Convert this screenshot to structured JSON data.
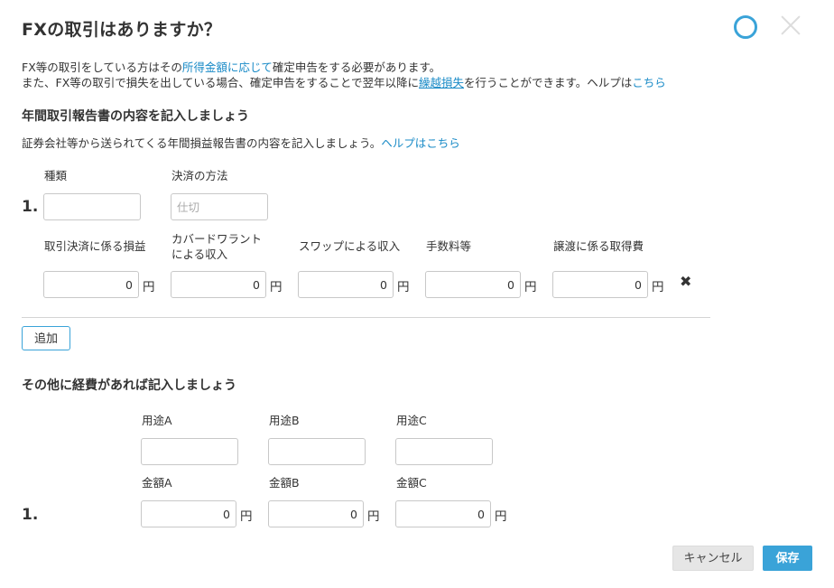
{
  "dialog": {
    "title": "FXの取引はありますか？",
    "colors": {
      "accent": "#3aa3d8",
      "link": "#1a8bc7"
    }
  },
  "intro": {
    "line1_prefix": "FX等の取引をしている方はその",
    "line1_link": "所得金額に応じて",
    "line1_suffix": "確定申告をする必要があります。",
    "line2_prefix": "また、FX等の取引で損失を出している場合、確定申告をすることで翌年以降に",
    "line2_link": "繰越損失",
    "line2_middle": "を行うことができます。ヘルプは",
    "line2_help_link": "こちら"
  },
  "report_section": {
    "title": "年間取引報告書の内容を記入しましょう",
    "desc_prefix": "証券会社等から送られてくる年間損益報告書の内容を記入しましょう。",
    "desc_link": "ヘルプはこちら",
    "row_number": "1.",
    "kind_label": "種類",
    "kind_value": "",
    "method_label": "決済の方法",
    "method_placeholder": "仕切",
    "amount_fields": [
      {
        "label": "取引決済に係る損益",
        "value": "0",
        "unit": "円"
      },
      {
        "label": "カバードワラントによる収入",
        "value": "0",
        "unit": "円"
      },
      {
        "label": "スワップによる収入",
        "value": "0",
        "unit": "円"
      },
      {
        "label": "手数料等",
        "value": "0",
        "unit": "円"
      },
      {
        "label": "譲渡に係る取得費",
        "value": "0",
        "unit": "円"
      }
    ],
    "delete_glyph": "✖",
    "add_label": "追加"
  },
  "expense_section": {
    "title": "その他に経費があれば記入しましょう",
    "row_number": "1.",
    "purpose_fields": [
      {
        "label": "用途A",
        "value": ""
      },
      {
        "label": "用途B",
        "value": ""
      },
      {
        "label": "用途C",
        "value": ""
      }
    ],
    "amount_fields": [
      {
        "label": "金額A",
        "value": "0",
        "unit": "円"
      },
      {
        "label": "金額B",
        "value": "0",
        "unit": "円"
      },
      {
        "label": "金額C",
        "value": "0",
        "unit": "円"
      }
    ]
  },
  "footer": {
    "cancel_label": "キャンセル",
    "save_label": "保存"
  }
}
